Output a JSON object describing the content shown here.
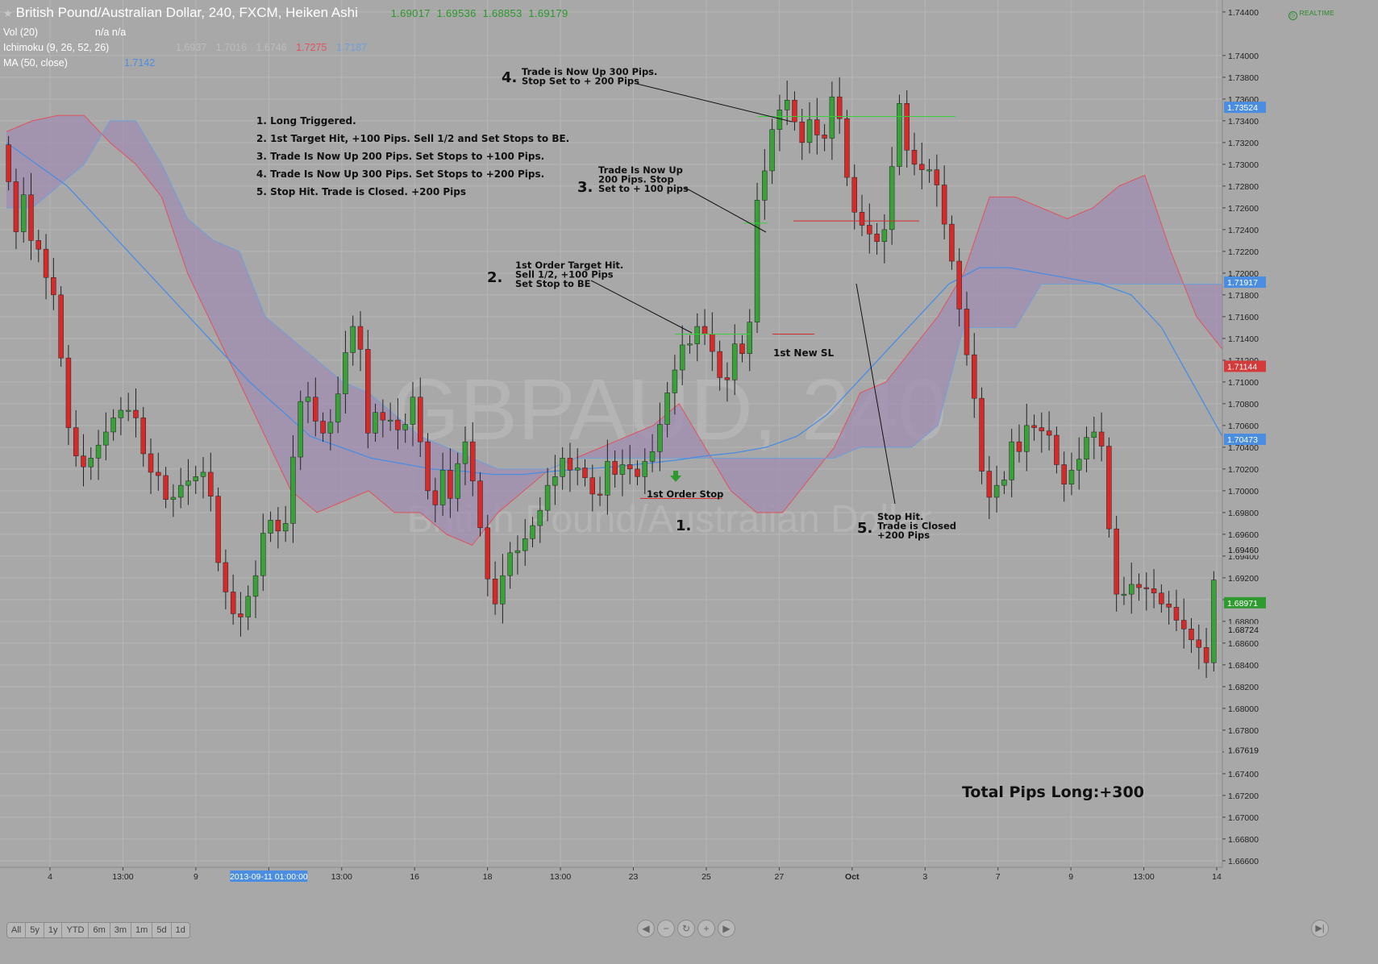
{
  "header": {
    "title": "British Pound/Australian Dollar, 240, FXCM, Heiken Ashi",
    "ohlc": [
      "1.69017",
      "1.69536",
      "1.68853",
      "1.69179"
    ],
    "volume_label": "Vol (20)",
    "volume_value": "n/a n/a",
    "ichimoku_label": "Ichimoku (9, 26, 52, 26)",
    "ichimoku_values": [
      {
        "text": "1.6937",
        "color": "#bdbdbd"
      },
      {
        "text": "1.7016",
        "color": "#bdbdbd"
      },
      {
        "text": "1.6746",
        "color": "#bdbdbd"
      },
      {
        "text": "1.7275",
        "color": "#e0535b"
      },
      {
        "text": "1.7187",
        "color": "#6f9fd8"
      }
    ],
    "ma_label": "MA (50, close)",
    "ma_value": "1.7142",
    "realtime_label": "REALTIME"
  },
  "watermark": {
    "symbol": "GBPAUD, 240",
    "name": "British Pound/Australian Dollar"
  },
  "colors": {
    "background": "#a8a8a8",
    "bull": "#3aa03a",
    "bear": "#d42a2a",
    "cloud": "#a08db0",
    "span_a": "#e0535b",
    "span_b": "#6f9fd8",
    "ma": "#4b8de0",
    "grid": "#b6b6b6"
  },
  "chart_data": {
    "type": "candlestick",
    "style": "Heiken Ashi",
    "symbol": "GBPAUD",
    "timeframe": "240",
    "ylim": [
      1.6654,
      1.7451
    ],
    "y_ticks": [
      "1.74400",
      "1.74000",
      "1.73800",
      "1.73600",
      "1.73400",
      "1.73200",
      "1.73000",
      "1.72800",
      "1.72600",
      "1.72400",
      "1.72200",
      "1.72000",
      "1.71800",
      "1.71600",
      "1.71400",
      "1.71200",
      "1.71000",
      "1.70800",
      "1.70600",
      "1.70400",
      "1.70200",
      "1.70000",
      "1.69800",
      "1.69600",
      "1.69400",
      "1.69200",
      "1.69000",
      "1.68800",
      "1.68600",
      "1.68400",
      "1.68200",
      "1.68000",
      "1.67800",
      "1.67600",
      "1.67400",
      "1.67200",
      "1.67000",
      "1.66800",
      "1.66600"
    ],
    "price_badges": [
      {
        "value": "1.73524",
        "color": "#4b8de0"
      },
      {
        "value": "1.71917",
        "color": "#4b8de0"
      },
      {
        "value": "1.71144",
        "color": "#d43a3a"
      },
      {
        "value": "1.70473",
        "color": "#4b8de0"
      },
      {
        "value": "1.68971",
        "color": "#2f9a2f"
      }
    ],
    "price_plain": [
      "1.69460",
      "1.68724",
      "1.67619"
    ],
    "x_ticks": [
      "4",
      "13:00",
      "9",
      "2013-09-11 01:00:00",
      "13:00",
      "16",
      "18",
      "13:00",
      "23",
      "25",
      "27",
      "Oct",
      "3",
      "7",
      "9",
      "13:00",
      "14"
    ],
    "candles": {
      "open": [
        1.7318,
        1.7284,
        1.7238,
        1.7272,
        1.723,
        1.7222,
        1.7196,
        1.718,
        1.7122,
        1.7058,
        1.7032,
        1.7022,
        1.703,
        1.7042,
        1.7054,
        1.7067,
        1.7074,
        1.7074,
        1.7067,
        1.7034,
        1.7017,
        1.7014,
        1.6992,
        1.6994,
        1.7005,
        1.7009,
        1.7013,
        1.7017,
        1.6995,
        1.6934,
        1.6907,
        1.6887,
        1.6884,
        1.6903,
        1.6922,
        1.6961,
        1.6973,
        1.6963,
        1.697,
        1.7031,
        1.7082,
        1.7086,
        1.7064,
        1.7053,
        1.7063,
        1.7089,
        1.7127,
        1.7151,
        1.713,
        1.7053,
        1.7072,
        1.7065,
        1.7065,
        1.7056,
        1.7061,
        1.7086,
        1.7045,
        1.7,
        1.6987,
        1.7019,
        1.6993,
        1.7025,
        1.7045,
        1.7009,
        1.6966,
        1.6919,
        1.6896,
        1.6922,
        1.6943,
        1.6945,
        1.6956,
        1.6968,
        1.6982,
        1.7005,
        1.7013,
        1.703,
        1.7019,
        1.7021,
        1.7012,
        1.6997,
        1.6996,
        1.7027,
        1.7015,
        1.7024,
        1.702,
        1.7013,
        1.7027,
        1.7036,
        1.7061,
        1.709,
        1.7111,
        1.7134,
        1.7135,
        1.7151,
        1.7144,
        1.7128,
        1.7104,
        1.7102,
        1.7135,
        1.7126,
        1.7155,
        1.7267,
        1.7294,
        1.7332,
        1.735,
        1.7359,
        1.7339,
        1.732,
        1.7341,
        1.7327,
        1.7324,
        1.7362,
        1.7342,
        1.7288,
        1.7256,
        1.7244,
        1.7236,
        1.7229,
        1.724,
        1.7298,
        1.7356,
        1.7313,
        1.73,
        1.7295,
        1.7295,
        1.7281,
        1.7245,
        1.7211,
        1.7167,
        1.7125,
        1.7085,
        1.7018,
        1.6994,
        1.7005,
        1.701,
        1.7045,
        1.7036,
        1.706,
        1.7058,
        1.7055,
        1.7051,
        1.7024,
        1.7006,
        1.7019,
        1.7029,
        1.7049,
        1.7054,
        1.7041,
        1.6965,
        1.6905,
        1.6905,
        1.6914,
        1.6911,
        1.691,
        1.6906,
        1.6896,
        1.6893,
        1.6881,
        1.6873,
        1.6863,
        1.6856,
        1.6842
      ],
      "close": [
        1.7284,
        1.7238,
        1.7272,
        1.723,
        1.7222,
        1.7196,
        1.718,
        1.7122,
        1.7058,
        1.7032,
        1.7022,
        1.703,
        1.7042,
        1.7054,
        1.7067,
        1.7074,
        1.7074,
        1.7067,
        1.7034,
        1.7017,
        1.7014,
        1.6992,
        1.6994,
        1.7005,
        1.7009,
        1.7013,
        1.7017,
        1.6995,
        1.6934,
        1.6907,
        1.6887,
        1.6884,
        1.6903,
        1.6922,
        1.6961,
        1.6973,
        1.6963,
        1.697,
        1.7031,
        1.7082,
        1.7086,
        1.7064,
        1.7053,
        1.7063,
        1.7089,
        1.7127,
        1.7151,
        1.713,
        1.7053,
        1.7072,
        1.7065,
        1.7065,
        1.7056,
        1.7061,
        1.7086,
        1.7045,
        1.7,
        1.6987,
        1.7019,
        1.6993,
        1.7025,
        1.7045,
        1.7009,
        1.6966,
        1.6919,
        1.6896,
        1.6922,
        1.6943,
        1.6945,
        1.6956,
        1.6968,
        1.6982,
        1.7005,
        1.7013,
        1.703,
        1.7019,
        1.7021,
        1.7012,
        1.6997,
        1.6996,
        1.7027,
        1.7015,
        1.7024,
        1.702,
        1.7013,
        1.7027,
        1.7036,
        1.7061,
        1.709,
        1.7111,
        1.7134,
        1.7135,
        1.7151,
        1.7144,
        1.7128,
        1.7104,
        1.7102,
        1.7135,
        1.7126,
        1.7155,
        1.7267,
        1.7294,
        1.7332,
        1.735,
        1.7359,
        1.7339,
        1.732,
        1.7341,
        1.7327,
        1.7324,
        1.7362,
        1.7342,
        1.7288,
        1.7256,
        1.7244,
        1.7236,
        1.7229,
        1.724,
        1.7298,
        1.7356,
        1.7313,
        1.73,
        1.7295,
        1.7295,
        1.7281,
        1.7245,
        1.7211,
        1.7167,
        1.7125,
        1.7085,
        1.7018,
        1.6994,
        1.7005,
        1.701,
        1.7045,
        1.7036,
        1.706,
        1.7058,
        1.7055,
        1.7051,
        1.7024,
        1.7006,
        1.7019,
        1.7029,
        1.7049,
        1.7054,
        1.7041,
        1.6965,
        1.6905,
        1.6905,
        1.6914,
        1.6911,
        1.691,
        1.6906,
        1.6896,
        1.6893,
        1.6881,
        1.6873,
        1.6863,
        1.6856,
        1.6842,
        1.6918
      ],
      "count": 165,
      "y_range": [
        1.68,
        1.742
      ]
    },
    "ichimoku_cloud": {
      "span_a": [
        1.733,
        1.734,
        1.7345,
        1.7345,
        1.732,
        1.73,
        1.727,
        1.72,
        1.715,
        1.71,
        1.705,
        1.7,
        1.698,
        1.699,
        1.7,
        1.698,
        1.698,
        1.696,
        1.695,
        1.698,
        1.7,
        1.702,
        1.703,
        1.704,
        1.705,
        1.706,
        1.708,
        1.704,
        1.7,
        1.698,
        1.698,
        1.701,
        1.704,
        1.709,
        1.71,
        1.713,
        1.716,
        1.72,
        1.727,
        1.727,
        1.726,
        1.725,
        1.726,
        1.728,
        1.729,
        1.722,
        1.716,
        1.713
      ],
      "span_b": [
        1.726,
        1.726,
        1.728,
        1.73,
        1.734,
        1.734,
        1.73,
        1.725,
        1.723,
        1.722,
        1.716,
        1.714,
        1.712,
        1.71,
        1.709,
        1.707,
        1.705,
        1.704,
        1.703,
        1.702,
        1.702,
        1.702,
        1.703,
        1.703,
        1.703,
        1.703,
        1.703,
        1.703,
        1.703,
        1.703,
        1.703,
        1.703,
        1.703,
        1.704,
        1.704,
        1.704,
        1.706,
        1.715,
        1.715,
        1.715,
        1.719,
        1.719,
        1.719,
        1.719,
        1.719,
        1.719,
        1.719,
        1.719
      ]
    },
    "ma50": [
      1.732,
      1.73,
      1.728,
      1.725,
      1.722,
      1.719,
      1.716,
      1.713,
      1.71,
      1.7075,
      1.705,
      1.704,
      1.703,
      1.7025,
      1.702,
      1.7018,
      1.7015,
      1.7015,
      1.7018,
      1.702,
      1.7022,
      1.7025,
      1.7028,
      1.7032,
      1.7035,
      1.704,
      1.705,
      1.707,
      1.71,
      1.713,
      1.716,
      1.719,
      1.7205,
      1.7205,
      1.72,
      1.7195,
      1.719,
      1.718,
      1.715,
      1.71,
      1.705
    ],
    "annotations": {
      "summary": [
        "1. Long Triggered.",
        "2. 1st Target Hit, +100 Pips. Sell 1/2 and Set Stops to BE.",
        "3. Trade Is Now Up 200 Pips. Set Stops to +100 Pips.",
        "4. Trade Is Now Up 300 Pips. Set Stops to +200 Pips.",
        "5. Stop Hit. Trade is Closed. +200 Pips"
      ],
      "step1": {
        "num": "1.",
        "label": "1st Order Stop"
      },
      "step2": {
        "num": "2.",
        "lines": [
          "1st Order Target Hit.",
          "Sell 1/2, +100 Pips",
          "Set Stop to BE"
        ]
      },
      "step3": {
        "num": "3.",
        "lines": [
          "Trade Is Now Up",
          "200 Pips. Stop",
          "Set to + 100 pips"
        ]
      },
      "step4": {
        "num": "4.",
        "lines": [
          "Trade is Now Up 300 Pips.",
          "Stop Set to + 200 Pips"
        ]
      },
      "step5": {
        "num": "5.",
        "lines": [
          "Stop Hit.",
          "Trade is Closed",
          "+200 Pips"
        ]
      },
      "new_sl": "1st New SL",
      "total": "Total Pips Long:+300"
    }
  },
  "controls": {
    "zoom": [
      "All",
      "5y",
      "1y",
      "YTD",
      "6m",
      "3m",
      "1m",
      "5d",
      "1d"
    ],
    "nav": [
      "◀",
      "−",
      "↻",
      "+",
      "▶"
    ],
    "go_end": "▶|"
  }
}
